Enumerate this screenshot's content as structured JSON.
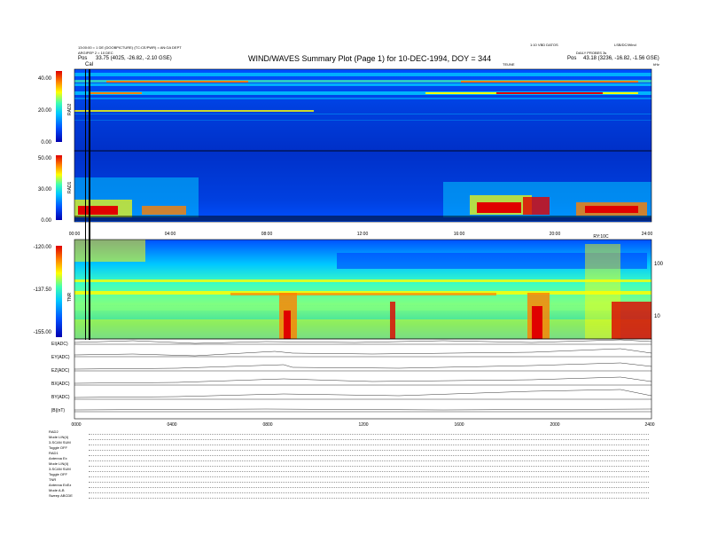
{
  "header": {
    "left_line1": "13:00:00 = 1 DE (DOOBPICTURE) (TC:CE/PWR) = AN:GA DEPT",
    "left_line2": "ARGIPEP 2 = 10 DEC",
    "left_pos_label": "Pos",
    "left_pos_value": "33.75 (4025, -26.82, -2.10 GSE)",
    "title": "WIND/WAVES Summary Plot (Page 1) for 10-DEC-1994, DOY = 344",
    "right_line1": "1:10 VBD DATOS",
    "right_line1b": "LSB/DC/Wind",
    "right_line2": "DAILY PROBES 3s",
    "right_pos_label": "Pos",
    "right_pos_value": "43.18 (3236, -16.82, -1.56 GSE)",
    "small_top_label": "TEUNE",
    "small_top_label_right": "kHz",
    "cal_label": "Cal"
  },
  "rad2_panel": {
    "label": "RAD2",
    "ticks": [
      "40.00",
      "20.00",
      "0.00"
    ]
  },
  "rad1_panel": {
    "label": "RAD1",
    "ticks": [
      "50.00",
      "30.00",
      "0.00"
    ]
  },
  "time_axis_1": [
    "00:00",
    "04:00",
    "08:00",
    "12:00",
    "16:00",
    "20:00",
    "24:00"
  ],
  "time_axis_1_extra": "RY:10C",
  "tnr_panel": {
    "label": "TNR",
    "ticks": [
      "-120.00",
      "-137.50",
      "-155.00"
    ],
    "right_ticks": [
      "100",
      "10"
    ]
  },
  "lines_panel": {
    "rows": [
      "EI(ADC)",
      "EY(ADC)",
      "EZ(ADC)",
      "BX(ADC)",
      "BY(ADC)",
      "|B|(nT)"
    ]
  },
  "time_axis_2": [
    "0000",
    "0400",
    "0800",
    "1200",
    "1600",
    "2000",
    "2400"
  ],
  "bottom_info": [
    "RAD2",
    "Mode LIN(4)",
    "3-SCAN SUM",
    "Toggle OFF",
    "RAD1",
    "Antenna Ex",
    "Mode LIN(4)",
    "3-SCAN SUM",
    "Toggle OFF",
    "TNR",
    "Antenna ExEz",
    "Mode A-B",
    "Sweep ABCDE"
  ],
  "colorscale": [
    "#0000b0",
    "#0040ff",
    "#00c8ff",
    "#40ffb0",
    "#ffff00",
    "#ff8000",
    "#e00000"
  ],
  "chart_data": {
    "type": "heatmap",
    "title": "WIND/WAVES Summary Plot (Page 1) for 10-DEC-1994, DOY = 344",
    "xlabel": "",
    "x_ticks": [
      "00:00",
      "04:00",
      "08:00",
      "12:00",
      "16:00",
      "20:00",
      "24:00"
    ],
    "panels": [
      {
        "name": "RAD2",
        "yticks": [
          "0.00",
          "20.00",
          "40.00"
        ]
      },
      {
        "name": "RAD1",
        "yticks": [
          "0.00",
          "30.00",
          "50.00"
        ]
      },
      {
        "name": "TNR",
        "yticks": [
          "-155.00",
          "-137.50",
          "-120.00"
        ]
      }
    ]
  }
}
